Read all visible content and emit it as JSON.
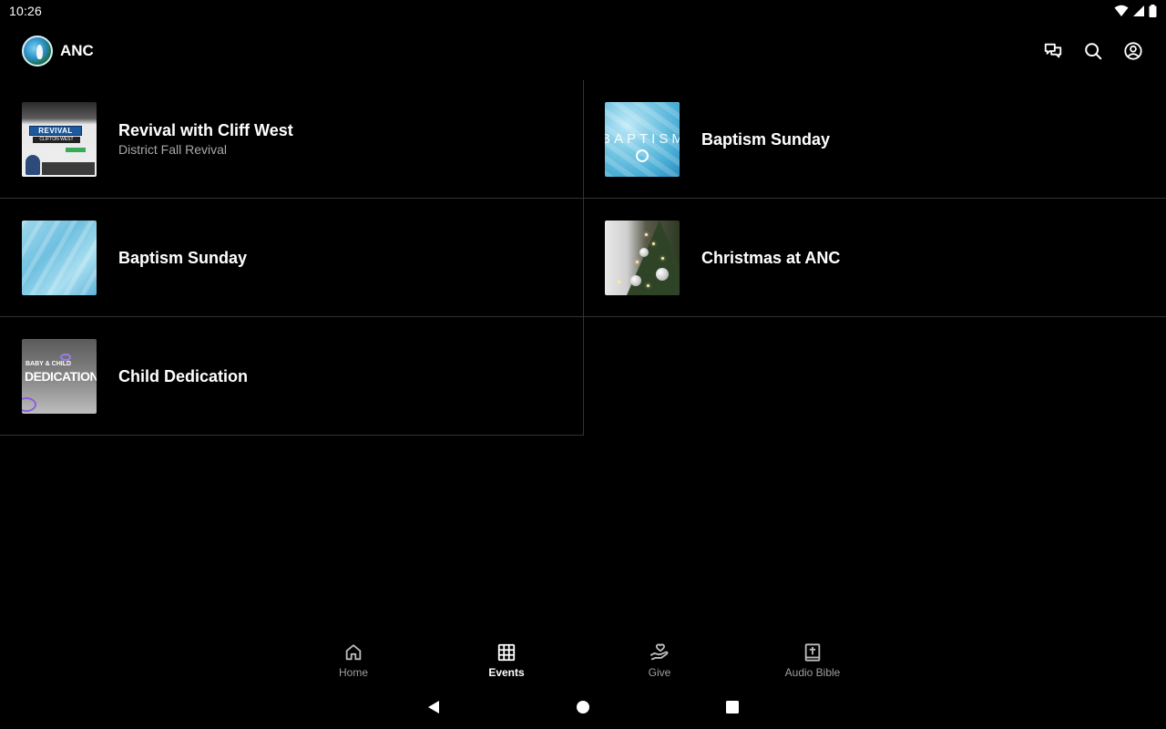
{
  "status_bar": {
    "time": "10:26"
  },
  "app_bar": {
    "brand_name": "ANC",
    "actions": [
      "chat-icon",
      "search-icon",
      "account-icon"
    ]
  },
  "events": [
    {
      "title": "Revival with Cliff West",
      "subtitle": "District Fall Revival",
      "thumb": "revival"
    },
    {
      "title": "Baptism Sunday",
      "subtitle": "",
      "thumb": "baptism-ice",
      "thumb_text": "BAPTISM"
    },
    {
      "title": "Baptism Sunday",
      "subtitle": "",
      "thumb": "ice"
    },
    {
      "title": "Christmas at ANC",
      "subtitle": "",
      "thumb": "tree"
    },
    {
      "title": "Child Dedication",
      "subtitle": "",
      "thumb": "dedication",
      "thumb_small": "BABY & CHILD",
      "thumb_big": "DEDICATIONS"
    }
  ],
  "revival_thumb": {
    "badge": "REVIVAL",
    "sub": "CLIFTON WEST"
  },
  "bottom_nav": {
    "active": "Events",
    "items": [
      {
        "label": "Home",
        "icon": "home-icon"
      },
      {
        "label": "Events",
        "icon": "calendar-grid-icon"
      },
      {
        "label": "Give",
        "icon": "give-hand-heart-icon"
      },
      {
        "label": "Audio Bible",
        "icon": "bible-icon"
      }
    ]
  },
  "colors": {
    "background": "#000000",
    "divider": "#333333",
    "text": "#ffffff",
    "subtext": "#a8a8a8",
    "inactive": "#9e9e9e"
  }
}
